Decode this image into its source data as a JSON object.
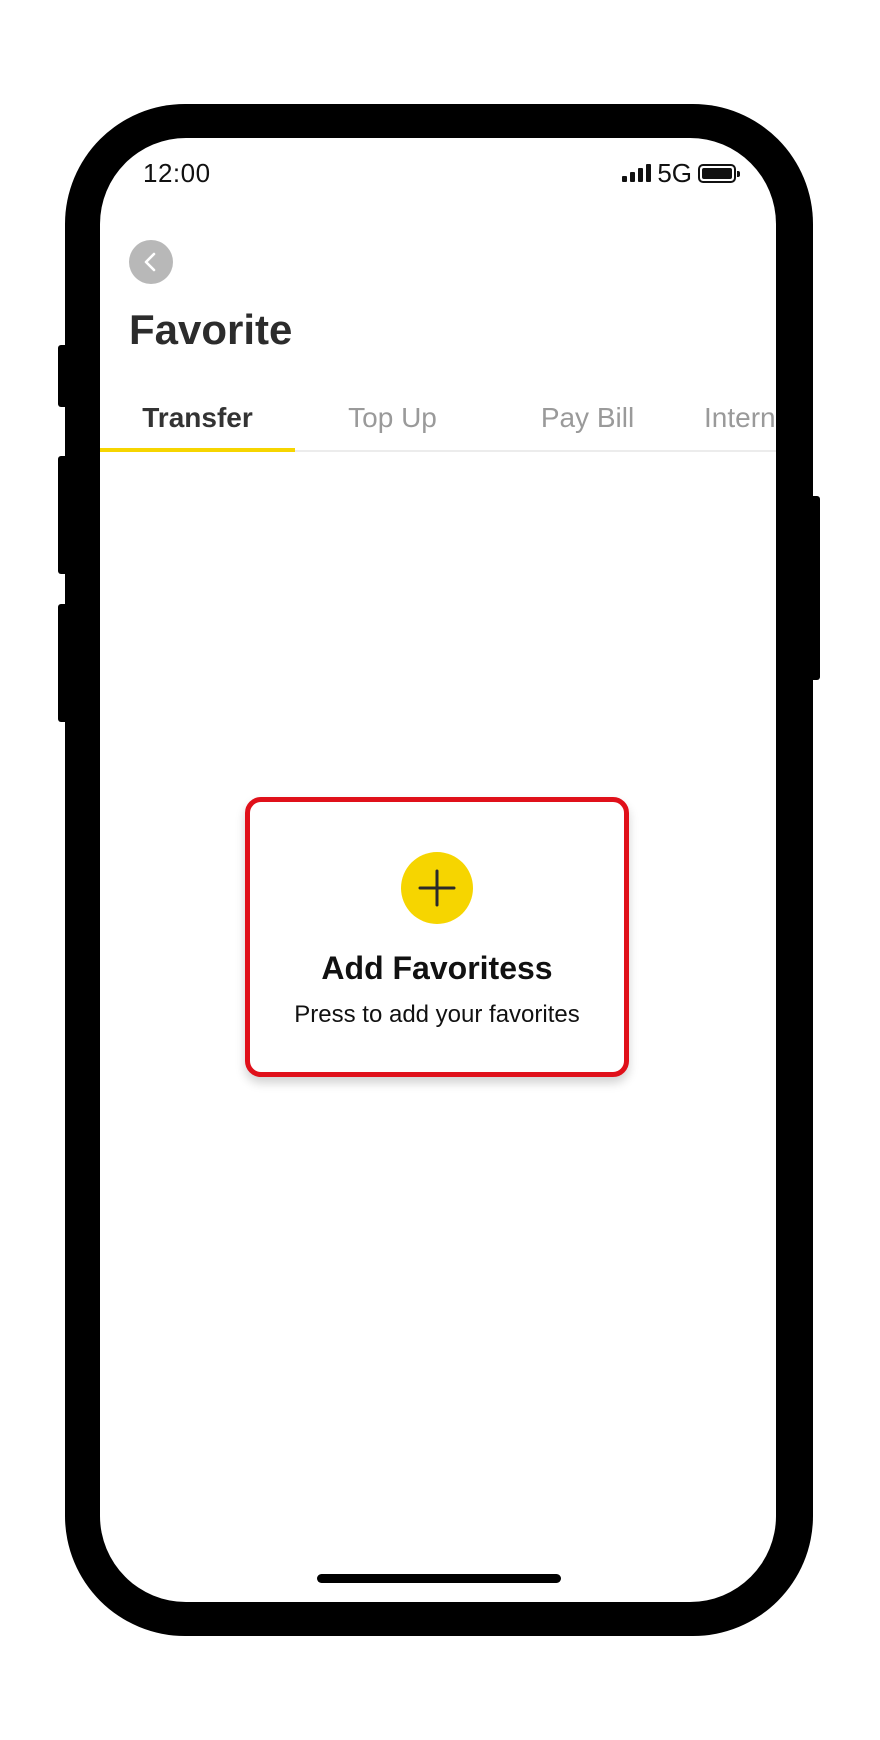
{
  "status_bar": {
    "time": "12:00",
    "network": "5G"
  },
  "header": {
    "title": "Favorite"
  },
  "tabs": [
    {
      "label": "Transfer",
      "active": true
    },
    {
      "label": "Top Up",
      "active": false
    },
    {
      "label": "Pay Bill",
      "active": false
    },
    {
      "label": "Intern",
      "active": false
    }
  ],
  "add_card": {
    "title": "Add Favoritess",
    "subtitle": "Press to add your favorites"
  },
  "colors": {
    "accent": "#f6d500",
    "highlight_border": "#e0101a",
    "back_button": "#b8b8b8"
  },
  "icons": {
    "back": "chevron-left-icon",
    "add": "plus-icon"
  }
}
